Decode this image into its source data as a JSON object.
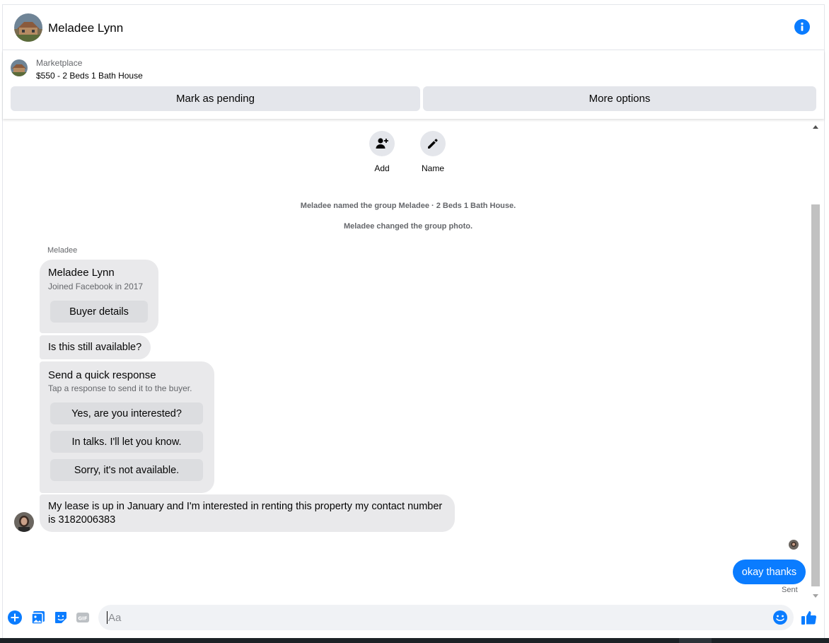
{
  "header": {
    "name": "Meladee Lynn"
  },
  "marketplace": {
    "label": "Marketplace",
    "title": "$550 - 2 Beds 1 Bath House",
    "mark_pending": "Mark as pending",
    "more_options": "More options"
  },
  "actions": {
    "add": "Add",
    "name": "Name"
  },
  "system_messages": [
    "Meladee named the group Meladee · 2 Beds 1 Bath House.",
    "Meladee changed the group photo."
  ],
  "sender_label": "Meladee",
  "buyer_card": {
    "title": "Meladee Lynn",
    "subtitle": "Joined Facebook in 2017",
    "button": "Buyer details"
  },
  "messages": {
    "availability": "Is this still available?",
    "lease": "My lease is up in January and I'm interested in renting this property my contact number is 3182006383",
    "reply": "okay thanks",
    "status": "Sent"
  },
  "quick_response": {
    "title": "Send a quick response",
    "subtitle": "Tap a response to send it to the buyer.",
    "options": [
      "Yes, are you interested?",
      "In talks. I'll let you know.",
      "Sorry, it's not available."
    ]
  },
  "composer": {
    "placeholder": "Aa",
    "gif_label": "GIF"
  },
  "colors": {
    "accent": "#0a7cff",
    "bubble": "#e9e9eb"
  }
}
